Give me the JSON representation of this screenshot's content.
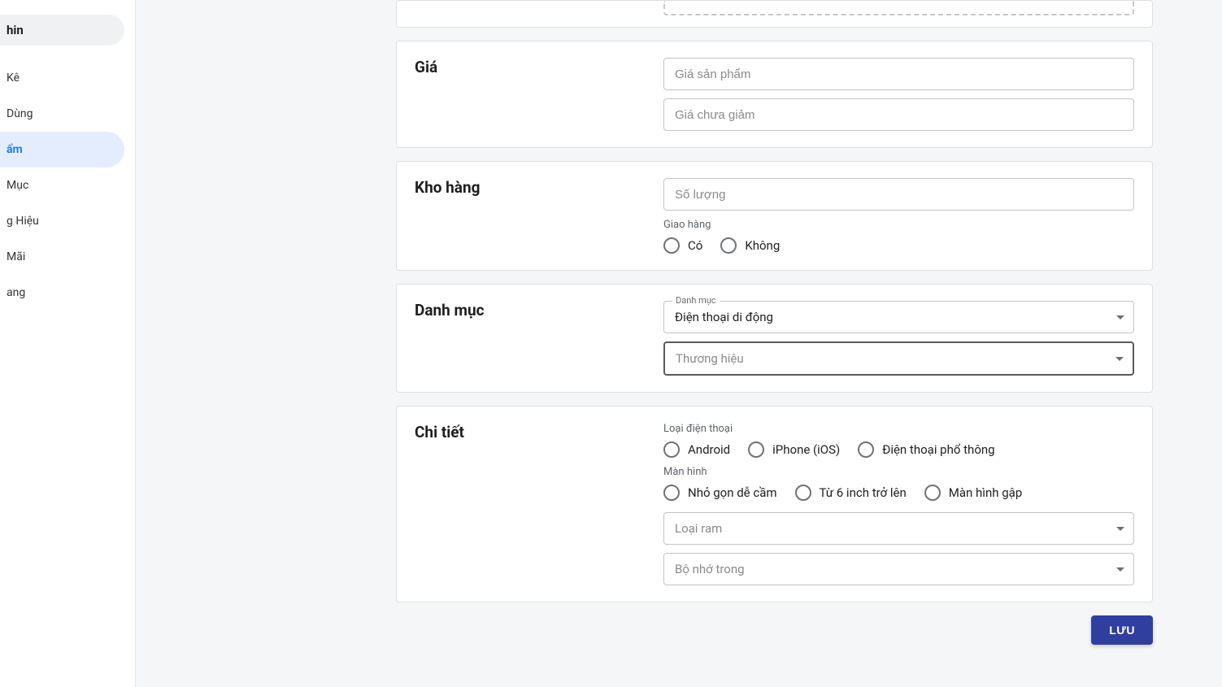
{
  "sidebar": {
    "header": "hin",
    "items": [
      {
        "label": "Kê"
      },
      {
        "label": "Dùng"
      },
      {
        "label": "ẩm"
      },
      {
        "label": "Mục"
      },
      {
        "label": "g Hiệu"
      },
      {
        "label": "Mãi"
      },
      {
        "label": "ang"
      }
    ]
  },
  "sections": {
    "price": {
      "title": "Giá",
      "product_price_placeholder": "Giá sản phẩm",
      "original_price_placeholder": "Giá chưa giảm"
    },
    "inventory": {
      "title": "Kho hàng",
      "quantity_placeholder": "Số lượng",
      "shipping_label": "Giao hàng",
      "option_yes": "Có",
      "option_no": "Không"
    },
    "category": {
      "title": "Danh mục",
      "category_legend": "Danh mục",
      "category_value": "Điện thoại di động",
      "brand_placeholder": "Thương hiệu"
    },
    "detail": {
      "title": "Chi tiết",
      "phone_type_label": "Loại điện thoại",
      "phone_type_options": [
        "Android",
        "iPhone (iOS)",
        "Điện thoại phổ thông"
      ],
      "screen_label": "Màn hình",
      "screen_options": [
        "Nhỏ gọn dễ cầm",
        "Từ 6 inch trở lên",
        "Màn hình gập"
      ],
      "ram_placeholder": "Loại ram",
      "storage_placeholder": "Bộ nhớ trong"
    }
  },
  "save_button": "LƯU"
}
